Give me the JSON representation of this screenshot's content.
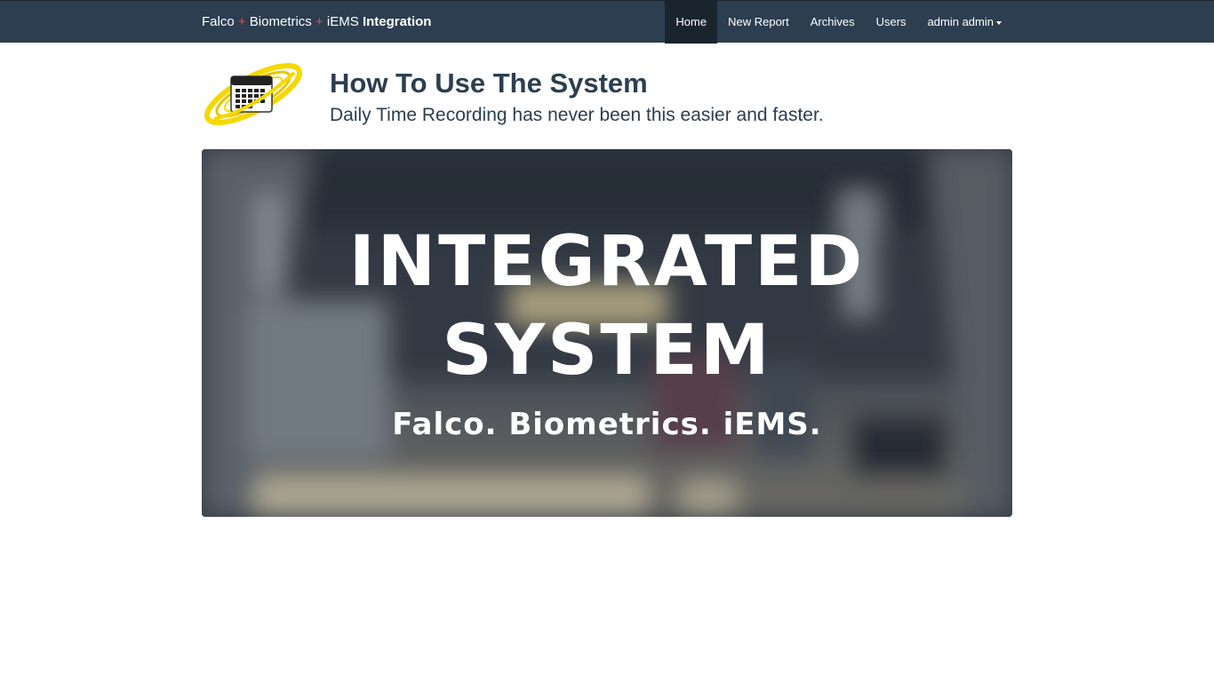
{
  "navbar": {
    "brand": {
      "part1": "Falco",
      "plus1": "+",
      "part2": "Biometrics",
      "plus2": "+",
      "part3": "iEMS",
      "part4": "Integration"
    },
    "items": [
      {
        "label": "Home",
        "active": true
      },
      {
        "label": "New Report",
        "active": false
      },
      {
        "label": "Archives",
        "active": false
      },
      {
        "label": "Users",
        "active": false
      },
      {
        "label": "admin admin",
        "active": false,
        "dropdown": true
      }
    ]
  },
  "header": {
    "logo_icon": "calendar-orbit-logo",
    "title": "How To Use The System",
    "subtitle": "Daily Time Recording has never been this easier and faster."
  },
  "banner": {
    "line1": "INTEGRATED",
    "line2": "SYSTEM",
    "line3": "Falco. Biometrics. iEMS."
  },
  "colors": {
    "navbar_bg": "#2c3e50",
    "navbar_active": "#1a242f",
    "brand_plus": "#e74c3c",
    "logo_ring": "#f5d800",
    "text": "#2c3e50"
  }
}
